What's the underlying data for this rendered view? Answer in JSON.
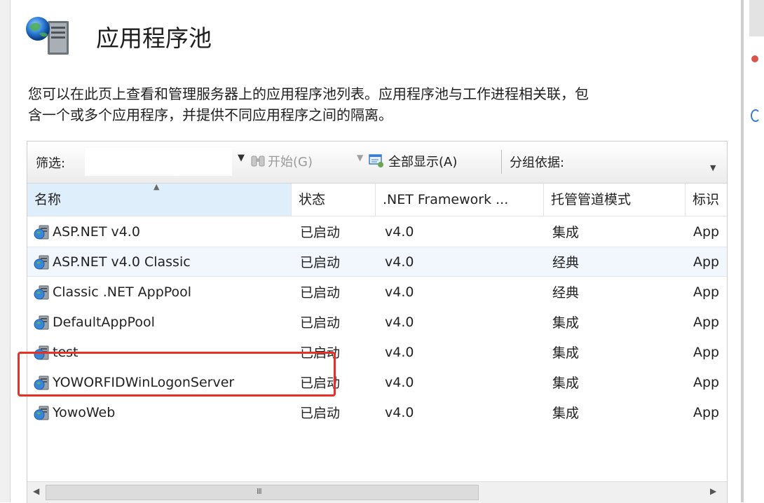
{
  "page": {
    "title": "应用程序池",
    "description_line1": "您可以在此页上查看和管理服务器上的应用程序池列表。应用程序池与工作进程相关联，包",
    "description_line2": "含一个或多个应用程序，并提供不同应用程序之间的隔离。"
  },
  "toolbar": {
    "filter_label": "筛选:",
    "filter_value": "",
    "start_label": "开始(G)",
    "show_all_label": "全部显示(A)",
    "group_by_label": "分组依据:"
  },
  "columns": [
    "名称",
    "状态",
    ".NET Framework ...",
    "托管管道模式",
    "标识"
  ],
  "rows": [
    {
      "name": "ASP.NET v4.0",
      "status": "已启动",
      "framework": "v4.0",
      "pipeline": "集成",
      "identity": "App"
    },
    {
      "name": "ASP.NET v4.0 Classic",
      "status": "已启动",
      "framework": "v4.0",
      "pipeline": "经典",
      "identity": "App"
    },
    {
      "name": "Classic .NET AppPool",
      "status": "已启动",
      "framework": "v4.0",
      "pipeline": "经典",
      "identity": "App"
    },
    {
      "name": "DefaultAppPool",
      "status": "已启动",
      "framework": "v4.0",
      "pipeline": "集成",
      "identity": "App"
    },
    {
      "name": "test",
      "status": "已启动",
      "framework": "v4.0",
      "pipeline": "集成",
      "identity": "App"
    },
    {
      "name": "YOWORFIDWinLogonServer",
      "status": "已启动",
      "framework": "v4.0",
      "pipeline": "集成",
      "identity": "App"
    },
    {
      "name": "YowoWeb",
      "status": "已启动",
      "framework": "v4.0",
      "pipeline": "集成",
      "identity": "App"
    }
  ],
  "scrollbar": {
    "grip": "III"
  },
  "colors": {
    "highlight": "#e53127",
    "selected_row": "#f2f7fd",
    "accent": "#3b7bd0"
  }
}
